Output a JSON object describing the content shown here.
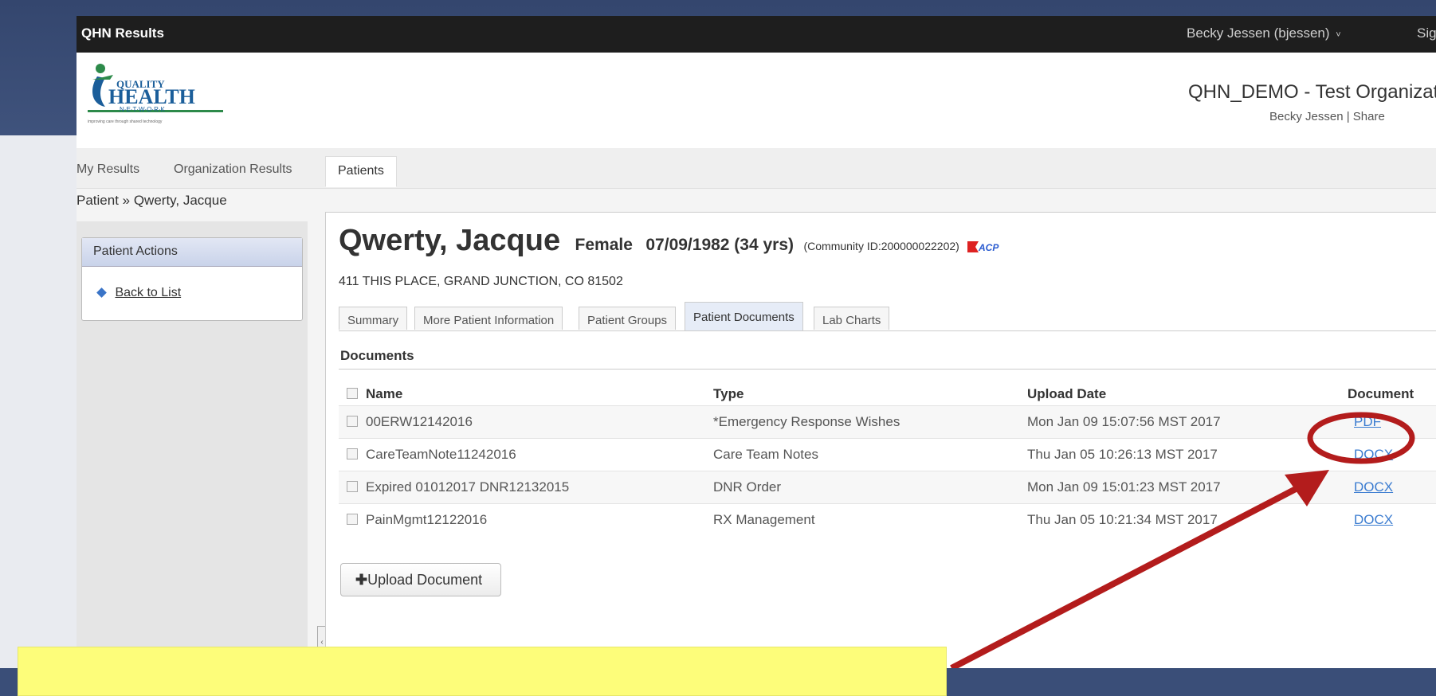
{
  "topbar": {
    "app_title": "QHN Results",
    "user": "Becky Jessen (bjessen)",
    "user_caret": "˅",
    "sign": "Sig"
  },
  "header": {
    "logo_text_top": "QUALITY",
    "logo_text_main": "HEALTH",
    "logo_text_network": "N·E·T·W·O·R·K",
    "logo_tagline": "improving care through shared technology",
    "org_name": "QHN_DEMO - Test Organizatio",
    "org_sub": "Becky Jessen  |  Share"
  },
  "nav_tabs": {
    "my_results": "My Results",
    "org_results": "Organization Results",
    "patients": "Patients"
  },
  "breadcrumb": "Patient » Qwerty, Jacque",
  "sidebar": {
    "header": "Patient Actions",
    "back_label": "Back to List"
  },
  "patient": {
    "name": "Qwerty, Jacque",
    "gender": "Female",
    "dob": "07/09/1982 (34 yrs)",
    "community_id": "(Community ID:200000022202)",
    "badge": "ACP",
    "address": "411 THIS PLACE, GRAND JUNCTION, CO 81502"
  },
  "patient_tabs": [
    "Summary",
    "More Patient Information",
    "Patient Groups",
    "Patient Documents",
    "Lab Charts"
  ],
  "documents": {
    "title": "Documents",
    "columns": [
      "Name",
      "Type",
      "Upload Date",
      "Document"
    ],
    "rows": [
      {
        "name": "00ERW12142016",
        "type": "*Emergency Response Wishes",
        "date": "Mon Jan 09 15:07:56 MST 2017",
        "doc": "PDF"
      },
      {
        "name": "CareTeamNote11242016",
        "type": "Care Team Notes",
        "date": "Thu Jan 05 10:26:13 MST 2017",
        "doc": "DOCX"
      },
      {
        "name": "Expired 01012017 DNR12132015",
        "type": "DNR Order",
        "date": "Mon Jan 09 15:01:23 MST 2017",
        "doc": "DOCX"
      },
      {
        "name": "PainMgmt12122016",
        "type": "RX Management",
        "date": "Thu Jan 05 10:21:34 MST 2017",
        "doc": "DOCX"
      }
    ],
    "upload_label": "Upload Document",
    "upload_icon": "✚"
  },
  "colors": {
    "annotation_red": "#b31c1c",
    "callout_yellow": "#fdfd7a",
    "link_blue": "#3b7cd0"
  }
}
